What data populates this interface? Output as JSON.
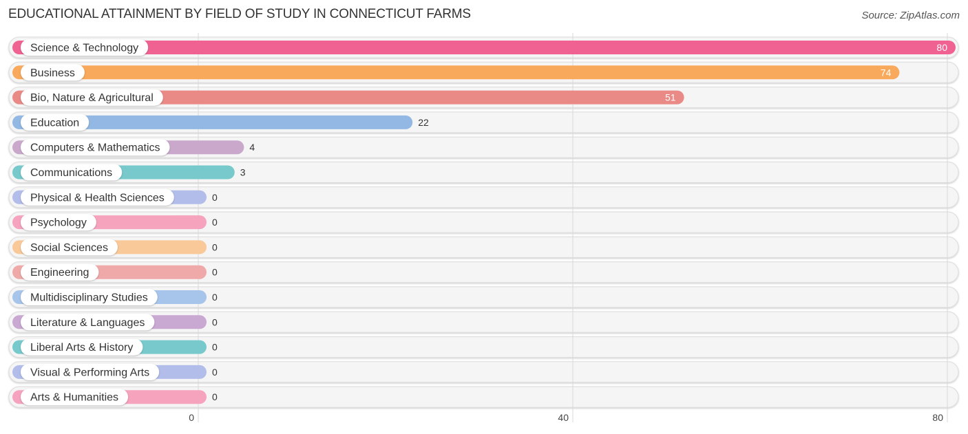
{
  "header": {
    "title": "EDUCATIONAL ATTAINMENT BY FIELD OF STUDY IN CONNECTICUT FARMS",
    "source": "Source: ZipAtlas.com"
  },
  "chart_data": {
    "type": "bar",
    "orientation": "horizontal",
    "title": "EDUCATIONAL ATTAINMENT BY FIELD OF STUDY IN CONNECTICUT FARMS",
    "xlabel": "",
    "ylabel": "",
    "xlim": [
      0,
      80
    ],
    "xticks": [
      0,
      40,
      80
    ],
    "xtick_labels": [
      "0",
      "40",
      "80"
    ],
    "grid": true,
    "categories": [
      "Science & Technology",
      "Business",
      "Bio, Nature & Agricultural",
      "Education",
      "Computers & Mathematics",
      "Communications",
      "Physical & Health Sciences",
      "Psychology",
      "Social Sciences",
      "Engineering",
      "Multidisciplinary Studies",
      "Literature & Languages",
      "Liberal Arts & History",
      "Visual & Performing Arts",
      "Arts & Humanities"
    ],
    "values": [
      80,
      74,
      51,
      22,
      4,
      3,
      0,
      0,
      0,
      0,
      0,
      0,
      0,
      0,
      0
    ],
    "value_labels": [
      "80",
      "74",
      "51",
      "22",
      "4",
      "3",
      "0",
      "0",
      "0",
      "0",
      "0",
      "0",
      "0",
      "0",
      "0"
    ],
    "colors": [
      "#f06292",
      "#f9a95c",
      "#e98a86",
      "#92b8e3",
      "#c9a8cc",
      "#77c9cc",
      "#b2bdea",
      "#f6a3bd",
      "#f9c999",
      "#efa9a9",
      "#a7c4ea",
      "#c9a8d2",
      "#77c9cc",
      "#b2bdea",
      "#f6a3bd"
    ]
  }
}
